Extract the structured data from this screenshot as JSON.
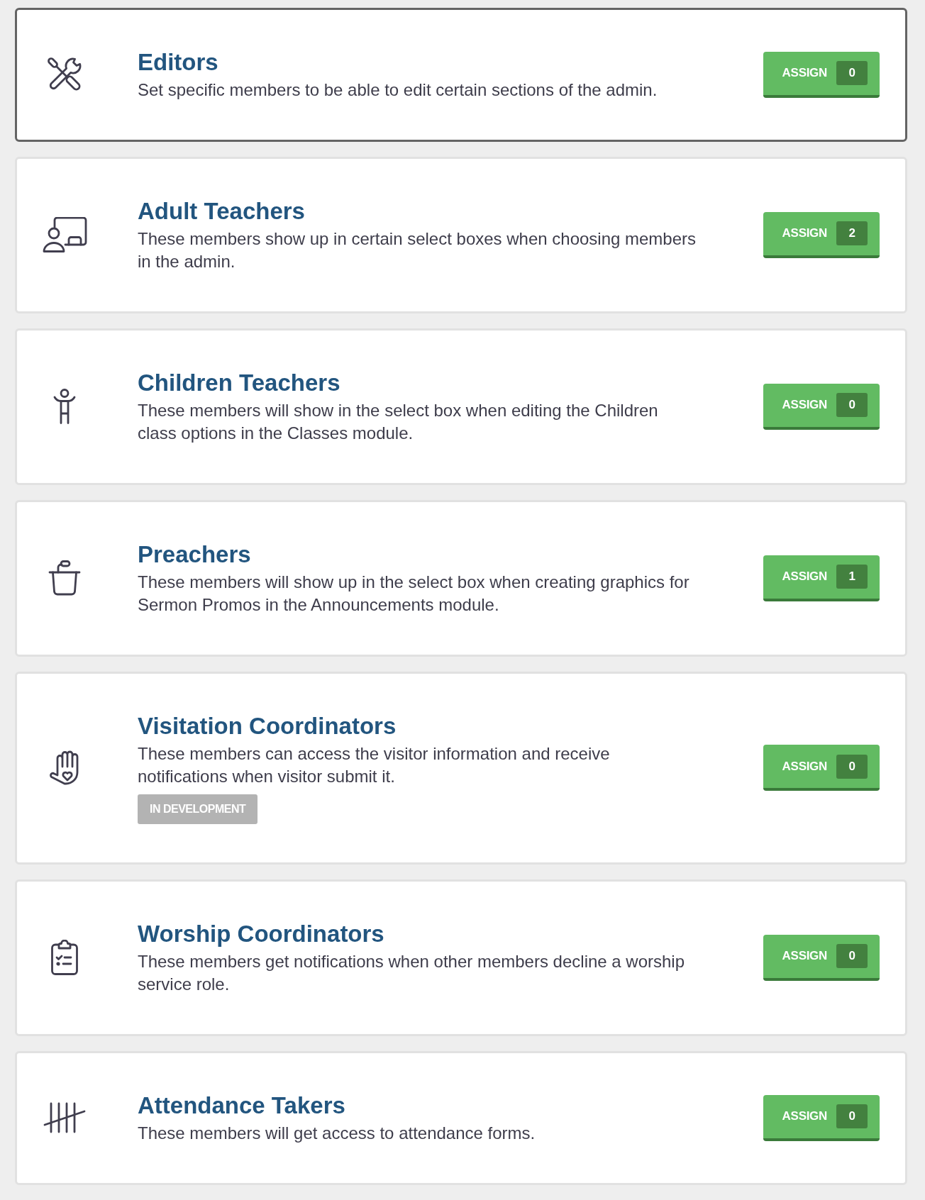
{
  "roles": [
    {
      "title": "Editors",
      "description": "Set specific members to be able to edit certain sections of the admin.",
      "selected": true,
      "button": {
        "label": "ASSIGN",
        "count": "0"
      }
    },
    {
      "title": "Adult Teachers",
      "description": "These members show up in certain select boxes when choosing members in the admin.",
      "selected": false,
      "button": {
        "label": "ASSIGN",
        "count": "2"
      }
    },
    {
      "title": "Children Teachers",
      "description": "These members will show in the select box when editing the Children class options in the Classes module.",
      "selected": false,
      "button": {
        "label": "ASSIGN",
        "count": "0"
      }
    },
    {
      "title": "Preachers",
      "description": "These members will show up in the select box when creating graphics for Sermon Promos in the Announcements module.",
      "selected": false,
      "button": {
        "label": "ASSIGN",
        "count": "1"
      }
    },
    {
      "title": "Visitation Coordinators",
      "description": "These members can access the visitor information and receive notifications when visitor submit it.",
      "status": "IN DEVELOPMENT",
      "selected": false,
      "button": {
        "label": "ASSIGN",
        "count": "0"
      }
    },
    {
      "title": "Worship Coordinators",
      "description": "These members get notifications when other members decline a worship service role.",
      "selected": false,
      "button": {
        "label": "ASSIGN",
        "count": "0"
      }
    },
    {
      "title": "Attendance Takers",
      "description": "These members will get access to attendance forms.",
      "selected": false,
      "button": {
        "label": "ASSIGN",
        "count": "0"
      }
    }
  ]
}
